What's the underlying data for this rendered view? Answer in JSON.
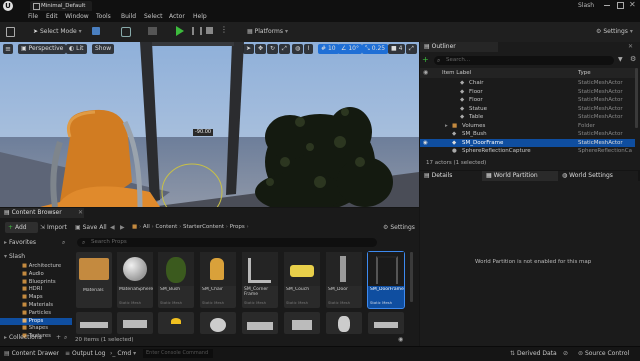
{
  "titlebar": {
    "tab": "Minimal_Default",
    "window_title": "Slash"
  },
  "menu": [
    "File",
    "Edit",
    "Window",
    "Tools",
    "Build",
    "Select",
    "Actor",
    "Help"
  ],
  "toolbar": {
    "mode": "Select Mode",
    "platforms": "Platforms",
    "settings": "Settings"
  },
  "viewport": {
    "perspective": "Perspective",
    "lit": "Lit",
    "show": "Show",
    "snap_angle": "10",
    "snap_rot": "10°",
    "scale_snap": "0.25",
    "cam_speed": "4",
    "gizmo_value": "-90.00"
  },
  "outliner": {
    "tab": "Outliner",
    "search_placeholder": "Search...",
    "col_label": "Item Label",
    "col_type": "Type",
    "rows": [
      {
        "label": "Chair",
        "type": "StaticMeshActor"
      },
      {
        "label": "Floor",
        "type": "StaticMeshActor"
      },
      {
        "label": "Floor",
        "type": "StaticMeshActor"
      },
      {
        "label": "Statue",
        "type": "StaticMeshActor"
      },
      {
        "label": "Table",
        "type": "StaticMeshActor"
      },
      {
        "label": "Volumes",
        "type": "Folder"
      },
      {
        "label": "SM_Bush",
        "type": "StaticMeshActor"
      },
      {
        "label": "SM_DoorFrame",
        "type": "StaticMeshActor"
      },
      {
        "label": "SphereReflectionCapture",
        "type": "SphereReflectionCa"
      }
    ],
    "count": "17 actors (1 selected)"
  },
  "details": {
    "tabs": [
      "Details",
      "World Partition",
      "World Settings"
    ],
    "message": "World Partition is not enabled for this map"
  },
  "content_browser": {
    "tab": "Content Browser",
    "add": "Add",
    "import": "Import",
    "save_all": "Save All",
    "path": [
      "All",
      "Content",
      "StarterContent",
      "Props"
    ],
    "settings": "Settings",
    "favorites": "Favorites",
    "search_placeholder": "Search Props",
    "root": "Slash",
    "tree": [
      "Architecture",
      "Audio",
      "Blueprints",
      "HDRI",
      "Maps",
      "Materials",
      "Particles",
      "Props",
      "Shapes",
      "Textures"
    ],
    "collections": "Collections",
    "items": [
      {
        "name": "Materials",
        "sub": ""
      },
      {
        "name": "MaterialSphere",
        "sub": "Static Mesh"
      },
      {
        "name": "SM_Bush",
        "sub": "Static Mesh"
      },
      {
        "name": "SM_Chair",
        "sub": "Static Mesh"
      },
      {
        "name": "SM_Corner Frame",
        "sub": "Static Mesh"
      },
      {
        "name": "SM_Couch",
        "sub": "Static Mesh"
      },
      {
        "name": "SM_Door",
        "sub": "Static Mesh"
      },
      {
        "name": "SM_DoorFrame",
        "sub": "Static Mesh"
      }
    ],
    "status": "20 items (1 selected)"
  },
  "statusbar": {
    "content_drawer": "Content Drawer",
    "output_log": "Output Log",
    "cmd": "Cmd",
    "console_placeholder": "Enter Console Command",
    "derived_data": "Derived Data",
    "source_control": "Source Control"
  },
  "colors": {
    "accent_blue": "#1f6fd6",
    "selected_row": "#0f4ea0",
    "play_green": "#3dbb3d",
    "folder_orange": "#c48a3f"
  }
}
